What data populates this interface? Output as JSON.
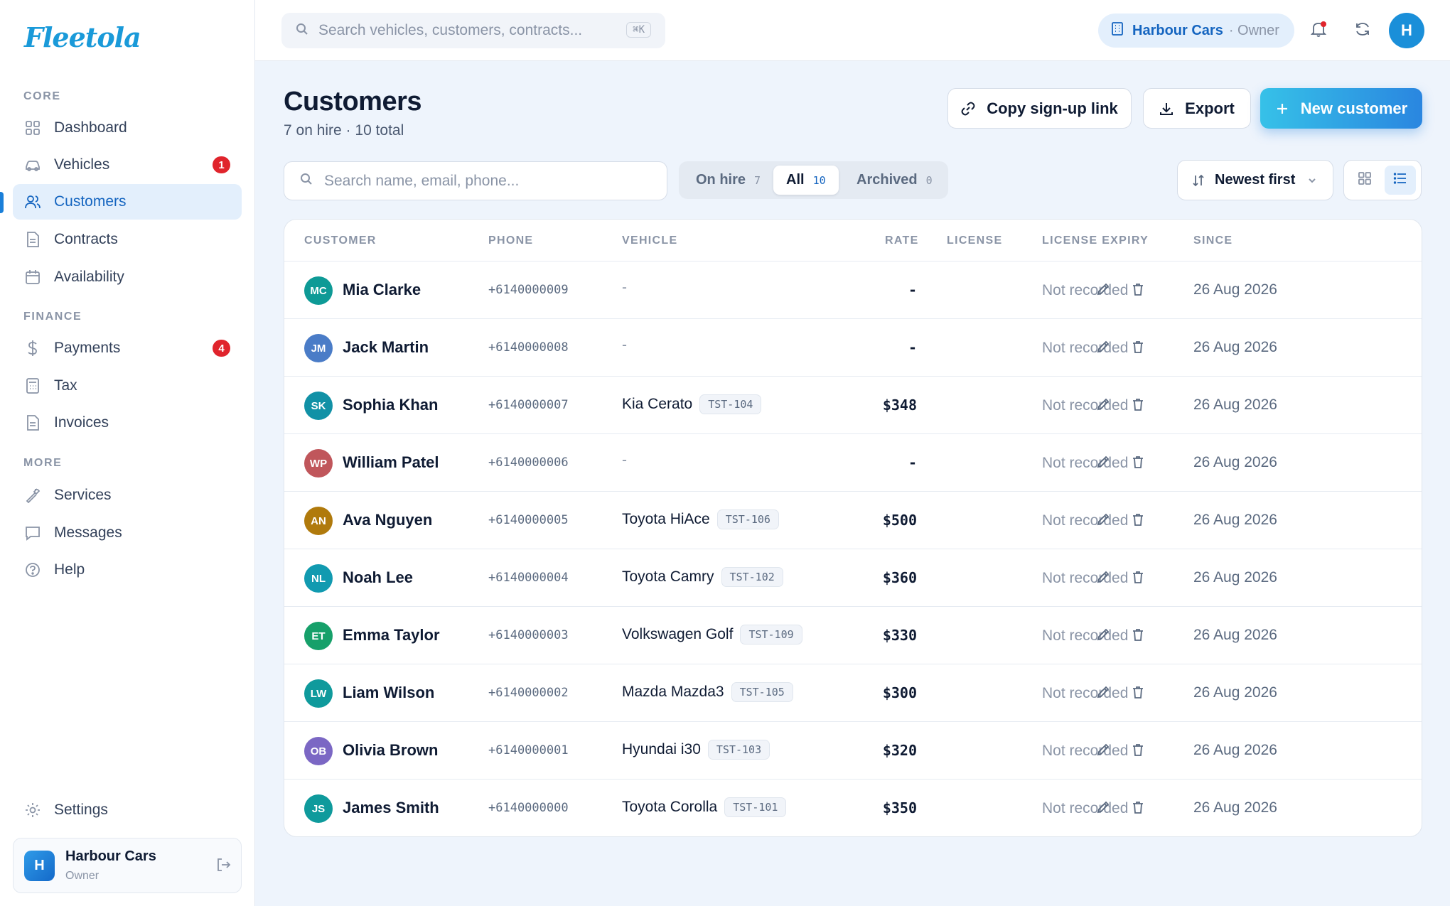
{
  "app": {
    "logo": "Fleetola",
    "brand_color": "#1a9ad9",
    "accent_color": "#1565c0",
    "badge_color": "#e0242c"
  },
  "sidebar": {
    "sections": [
      {
        "title": "CORE",
        "items": [
          {
            "label": "Dashboard",
            "icon": "grid-icon"
          },
          {
            "label": "Vehicles",
            "icon": "car-icon",
            "badge": "1"
          },
          {
            "label": "Customers",
            "icon": "users-icon",
            "active": true
          },
          {
            "label": "Contracts",
            "icon": "file-icon"
          },
          {
            "label": "Availability",
            "icon": "calendar-icon"
          }
        ]
      },
      {
        "title": "FINANCE",
        "items": [
          {
            "label": "Payments",
            "icon": "dollar-icon",
            "badge": "4"
          },
          {
            "label": "Tax",
            "icon": "calculator-icon"
          },
          {
            "label": "Invoices",
            "icon": "file-icon"
          }
        ]
      },
      {
        "title": "MORE",
        "items": [
          {
            "label": "Services",
            "icon": "wrench-icon"
          },
          {
            "label": "Messages",
            "icon": "message-icon"
          },
          {
            "label": "Help",
            "icon": "help-icon"
          }
        ]
      }
    ],
    "settings_label": "Settings",
    "account": {
      "initial": "H",
      "name": "Harbour Cars",
      "role": "Owner"
    }
  },
  "topbar": {
    "search_placeholder": "Search vehicles, customers, contracts...",
    "shortcut": "⌘K",
    "org_name": "Harbour Cars",
    "org_role": "· Owner",
    "user_initial": "H"
  },
  "header": {
    "title": "Customers",
    "subtitle": "7 on hire · 10 total",
    "copy_link_label": "Copy sign-up link",
    "export_label": "Export",
    "new_customer_label": "New customer"
  },
  "filters": {
    "search_placeholder": "Search name, email, phone...",
    "tabs": [
      {
        "label": "On hire",
        "count": "7"
      },
      {
        "label": "All",
        "count": "10",
        "active": true
      },
      {
        "label": "Archived",
        "count": "0"
      }
    ],
    "sort_label": "Newest first"
  },
  "table": {
    "columns": [
      "CUSTOMER",
      "PHONE",
      "VEHICLE",
      "RATE",
      "LICENSE",
      "LICENSE EXPIRY",
      "SINCE"
    ],
    "rows": [
      {
        "initials": "MC",
        "color": "#0e9a96",
        "name": "Mia Clarke",
        "phone": "+6140000009",
        "vehicle": "-",
        "plate": "",
        "rate": "-",
        "license": "",
        "expiry": "Not recorded",
        "since": "26 Aug 2026"
      },
      {
        "initials": "JM",
        "color": "#4a7cc7",
        "name": "Jack Martin",
        "phone": "+6140000008",
        "vehicle": "-",
        "plate": "",
        "rate": "-",
        "license": "",
        "expiry": "Not recorded",
        "since": "26 Aug 2026"
      },
      {
        "initials": "SK",
        "color": "#1191a6",
        "name": "Sophia Khan",
        "phone": "+6140000007",
        "vehicle": "Kia Cerato",
        "plate": "TST-104",
        "rate": "$348",
        "license": "",
        "expiry": "Not recorded",
        "since": "26 Aug 2026"
      },
      {
        "initials": "WP",
        "color": "#c0565b",
        "name": "William Patel",
        "phone": "+6140000006",
        "vehicle": "-",
        "plate": "",
        "rate": "-",
        "license": "",
        "expiry": "Not recorded",
        "since": "26 Aug 2026"
      },
      {
        "initials": "AN",
        "color": "#b07a0c",
        "name": "Ava Nguyen",
        "phone": "+6140000005",
        "vehicle": "Toyota HiAce",
        "plate": "TST-106",
        "rate": "$500",
        "license": "",
        "expiry": "Not recorded",
        "since": "26 Aug 2026"
      },
      {
        "initials": "NL",
        "color": "#119ab0",
        "name": "Noah Lee",
        "phone": "+6140000004",
        "vehicle": "Toyota Camry",
        "plate": "TST-102",
        "rate": "$360",
        "license": "",
        "expiry": "Not recorded",
        "since": "26 Aug 2026"
      },
      {
        "initials": "ET",
        "color": "#16a06a",
        "name": "Emma Taylor",
        "phone": "+6140000003",
        "vehicle": "Volkswagen Golf",
        "plate": "TST-109",
        "rate": "$330",
        "license": "",
        "expiry": "Not recorded",
        "since": "26 Aug 2026"
      },
      {
        "initials": "LW",
        "color": "#0f9a9c",
        "name": "Liam Wilson",
        "phone": "+6140000002",
        "vehicle": "Mazda Mazda3",
        "plate": "TST-105",
        "rate": "$300",
        "license": "",
        "expiry": "Not recorded",
        "since": "26 Aug 2026"
      },
      {
        "initials": "OB",
        "color": "#7b67c4",
        "name": "Olivia Brown",
        "phone": "+6140000001",
        "vehicle": "Hyundai i30",
        "plate": "TST-103",
        "rate": "$320",
        "license": "",
        "expiry": "Not recorded",
        "since": "26 Aug 2026"
      },
      {
        "initials": "JS",
        "color": "#0f9a9c",
        "name": "James Smith",
        "phone": "+6140000000",
        "vehicle": "Toyota Corolla",
        "plate": "TST-101",
        "rate": "$350",
        "license": "",
        "expiry": "Not recorded",
        "since": "26 Aug 2026"
      }
    ]
  }
}
